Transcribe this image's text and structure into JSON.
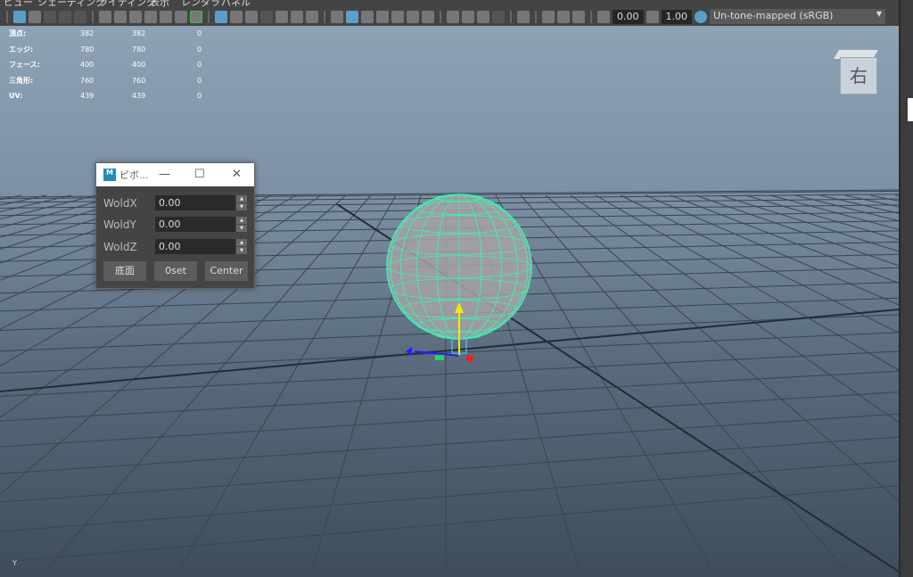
{
  "menu": [
    "ビュー",
    "シェーディング",
    "ライティング",
    "表示",
    "レンダラ",
    "パネル"
  ],
  "toolbar": {
    "exposure": "0.00",
    "gamma": "1.00",
    "color_space": "Un-tone-mapped (sRGB)",
    "dropdown_arrow": "▼"
  },
  "stats": [
    {
      "label": "頂点:",
      "a": "382",
      "b": "382",
      "c": "0"
    },
    {
      "label": "エッジ:",
      "a": "780",
      "b": "780",
      "c": "0"
    },
    {
      "label": "フェース:",
      "a": "400",
      "b": "400",
      "c": "0"
    },
    {
      "label": "三角形:",
      "a": "760",
      "b": "760",
      "c": "0"
    },
    {
      "label": "UV:",
      "a": "439",
      "b": "439",
      "c": "0"
    }
  ],
  "viewcube": {
    "label": "右"
  },
  "dialog": {
    "logo": "M",
    "title": "ピボ...",
    "minimize": "—",
    "maximize": "☐",
    "close": "✕",
    "fields": [
      {
        "label": "WoldX",
        "value": "0.00"
      },
      {
        "label": "WoldY",
        "value": "0.00"
      },
      {
        "label": "WoldZ",
        "value": "0.00"
      }
    ],
    "spin_up": "▲",
    "spin_down": "▼",
    "buttons": [
      "底面",
      "0set",
      "Center"
    ]
  },
  "axis_label": "Y",
  "colors": {
    "wireframe": "#3ef0b0",
    "accent": "#5b9fc8"
  }
}
